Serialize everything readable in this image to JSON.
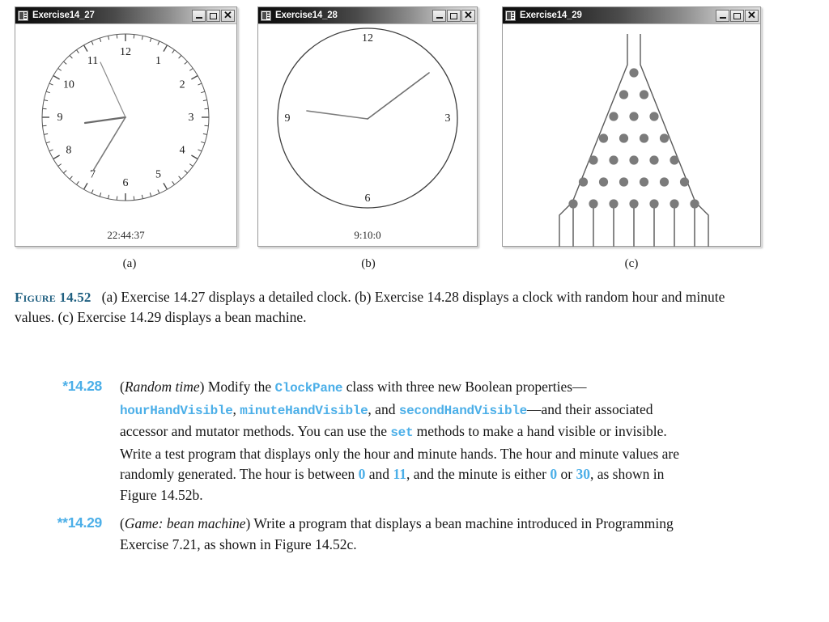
{
  "windows": [
    {
      "title": "Exercise14_27",
      "buttons": [
        "minimize",
        "maximize",
        "close"
      ],
      "content_type": "detailed-clock",
      "time_label": "22:44:37",
      "clock": {
        "numbers": [
          "12",
          "1",
          "2",
          "3",
          "4",
          "5",
          "6",
          "7",
          "8",
          "9",
          "10",
          "11"
        ],
        "tick_count": 60,
        "hands": {
          "hour_deg": 262,
          "minute_deg": 212,
          "second_deg": 329
        },
        "hour_value": 22,
        "minute_value": 44,
        "second_value": 37
      }
    },
    {
      "title": "Exercise14_28",
      "buttons": [
        "minimize",
        "maximize",
        "close"
      ],
      "content_type": "simple-clock",
      "time_label": "9:10:0",
      "clock": {
        "numbers": [
          "12",
          "3",
          "6",
          "9"
        ],
        "tick_count": 0,
        "hands": {
          "hour_deg": 275,
          "minute_deg": 60
        },
        "hour_value": 9,
        "minute_value": 10,
        "second_value": 0
      }
    },
    {
      "title": "Exercise14_29",
      "buttons": [
        "minimize",
        "maximize",
        "close"
      ],
      "content_type": "bean-machine",
      "bean_machine": {
        "peg_rows": 7,
        "pegs_per_row": [
          1,
          2,
          3,
          4,
          5,
          6,
          7
        ],
        "slot_count": 8,
        "peg_color": "#7b7b7b"
      }
    }
  ],
  "sublabels": [
    "(a)",
    "(b)",
    "(c)"
  ],
  "caption": {
    "figure_label": "Figure 14.52",
    "text": "(a) Exercise 14.27 displays a detailed clock. (b) Exercise 14.28 displays a clock with random hour and minute values. (c) Exercise 14.29 displays a bean machine."
  },
  "exercises": [
    {
      "number": "*14.28",
      "title": "Random time",
      "parts": {
        "p1": ") Modify the ",
        "c1": "ClockPane",
        "p2": " class with three new Boolean properties—",
        "c2": "hourHandVisible",
        "p3": ", ",
        "c3": "minuteHandVisible",
        "p4": ", and ",
        "c4": "secondHandVisible",
        "p5": "—and their associated accessor and mutator methods. You can use the ",
        "c5": "set",
        "p6": " methods to make a hand visible or invisible. Write a test program that displays only the hour and minute hands. The hour and minute values are randomly generated. The hour is between ",
        "n1": "0",
        "p7": " and ",
        "n2": "11",
        "p8": ", and the minute is either ",
        "n3": "0",
        "p9": " or ",
        "n4": "30",
        "p10": ", as shown in Figure 14.52b."
      }
    },
    {
      "number": "**14.29",
      "title": "Game: bean machine",
      "parts": {
        "p1": ") Write a program that displays a bean machine introduced in Programming Exercise 7.21, as shown in Figure 14.52c."
      }
    }
  ],
  "colors": {
    "accent_blue": "#4cafe8",
    "figure_label_blue": "#1f5f80",
    "peg_gray": "#7b7b7b",
    "stroke_gray": "#555555"
  }
}
